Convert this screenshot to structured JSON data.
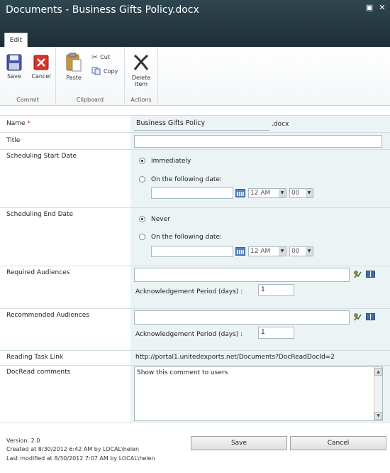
{
  "window": {
    "title": "Documents - Business Gifts Policy.docx",
    "maximize_glyph": "▣",
    "close_glyph": "✕"
  },
  "ribbon": {
    "tab_label": "Edit",
    "groups": {
      "commit": "Commit",
      "clipboard": "Clipboard",
      "actions": "Actions"
    },
    "buttons": {
      "save": "Save",
      "cancel": "Cancel",
      "paste": "Paste",
      "cut": "Cut",
      "copy": "Copy",
      "delete_item_line1": "Delete",
      "delete_item_line2": "Item"
    }
  },
  "form": {
    "name": {
      "label": "Name",
      "required_mark": "*",
      "value": "Business Gifts Policy",
      "suffix": ".docx"
    },
    "title": {
      "label": "Title",
      "value": ""
    },
    "sched_start": {
      "label": "Scheduling Start Date",
      "opt_immediately": "Immediately",
      "opt_following": "On the following date:",
      "selected": "Immediately",
      "hour": "12 AM",
      "minute": "00"
    },
    "sched_end": {
      "label": "Scheduling End Date",
      "opt_never": "Never",
      "opt_following": "On the following date:",
      "selected": "Never",
      "hour": "12 AM",
      "minute": "00"
    },
    "required_audiences": {
      "label": "Required Audiences",
      "value": "",
      "ack_label": "Acknowledgement Period (days) :",
      "ack_value": "1"
    },
    "recommended_audiences": {
      "label": "Recommended Audiences",
      "value": "",
      "ack_label": "Acknowledgement Period (days) :",
      "ack_value": "1"
    },
    "reading_task_link": {
      "label": "Reading Task Link",
      "value": "http://portal1.unitedexports.net/Documents?DocReadDocId=2"
    },
    "docread_comments": {
      "label": "DocRead comments",
      "value": "Show this comment to users"
    }
  },
  "footer": {
    "version": "Version: 2.0",
    "created": "Created at 8/30/2012 6:42 AM  by LOCAL\\helen",
    "modified": "Last modified at 8/30/2012 7:07 AM  by LOCAL\\helen",
    "save": "Save",
    "cancel": "Cancel"
  },
  "colors": {
    "titlebar": "#23353d",
    "field_background": "#ebf3f4",
    "required": "#cc2222"
  }
}
